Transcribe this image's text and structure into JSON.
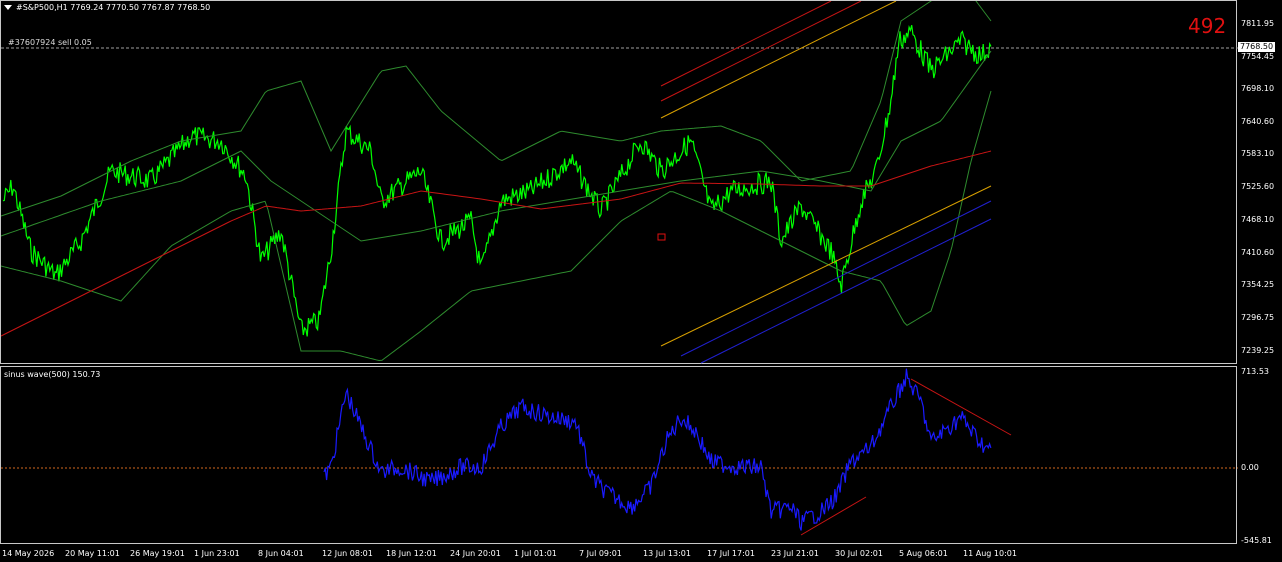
{
  "header": {
    "symbol_line": "#S&P500,H1  7769.24 7770.50 7767.87 7768.50",
    "order_line": "#37607924 sell 0.05",
    "counter": "492"
  },
  "oscillator": {
    "label": "sinus wave(500) 150.73",
    "scale": [
      "713.53",
      "0.00",
      "-545.81"
    ]
  },
  "price_scale": [
    "7811.95",
    "7754.45",
    "7698.10",
    "7640.60",
    "7583.10",
    "7525.60",
    "7468.10",
    "7410.60",
    "7354.25",
    "7296.75",
    "7239.25"
  ],
  "current_price": "7768.50",
  "time_axis": [
    "14 May 2026",
    "20 May 11:01",
    "26 May 19:01",
    "1 Jun 23:01",
    "8 Jun 04:01",
    "12 Jun 08:01",
    "18 Jun 12:01",
    "24 Jun 20:01",
    "1 Jul 01:01",
    "7 Jul 09:01",
    "13 Jul 13:01",
    "17 Jul 17:01",
    "23 Jul 21:01",
    "30 Jul 02:01",
    "5 Aug 06:01",
    "11 Aug 10:01"
  ],
  "colors": {
    "price_line": "#00ff00",
    "bands": "#2e8b2e",
    "ma_long": "#c81414",
    "oscillator": "#1a1aff",
    "channel_upper_red": "#c81414",
    "channel_upper_gold": "#d8a000",
    "channel_lower_blue": "#2020d0",
    "zero_line": "#d2691e"
  }
}
